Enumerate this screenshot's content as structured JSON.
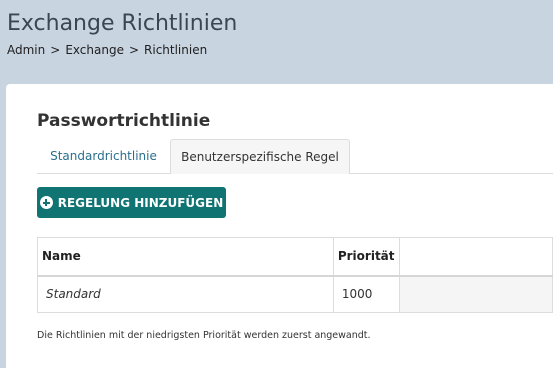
{
  "header": {
    "title": "Exchange Richtlinien",
    "breadcrumb": [
      "Admin",
      "Exchange",
      "Richtlinien"
    ],
    "breadcrumb_separator": ">"
  },
  "section": {
    "title": "Passwortrichtlinie"
  },
  "tabs": [
    {
      "label": "Standardrichtlinie",
      "active": false
    },
    {
      "label": "Benutzerspezifische Regel",
      "active": true
    }
  ],
  "add_button": {
    "label": "REGELUNG HINZUFÜGEN",
    "icon": "plus-circle-icon"
  },
  "table": {
    "columns": [
      "Name",
      "Priorität",
      ""
    ],
    "rows": [
      {
        "name": "Standard",
        "priority": "1000"
      }
    ]
  },
  "footnote": "Die Richtlinien mit der niedrigsten Priorität werden zuerst angewandt.",
  "colors": {
    "header_bg": "#c9d4e1",
    "accent": "#0f7472",
    "link": "#2a6f8e"
  }
}
